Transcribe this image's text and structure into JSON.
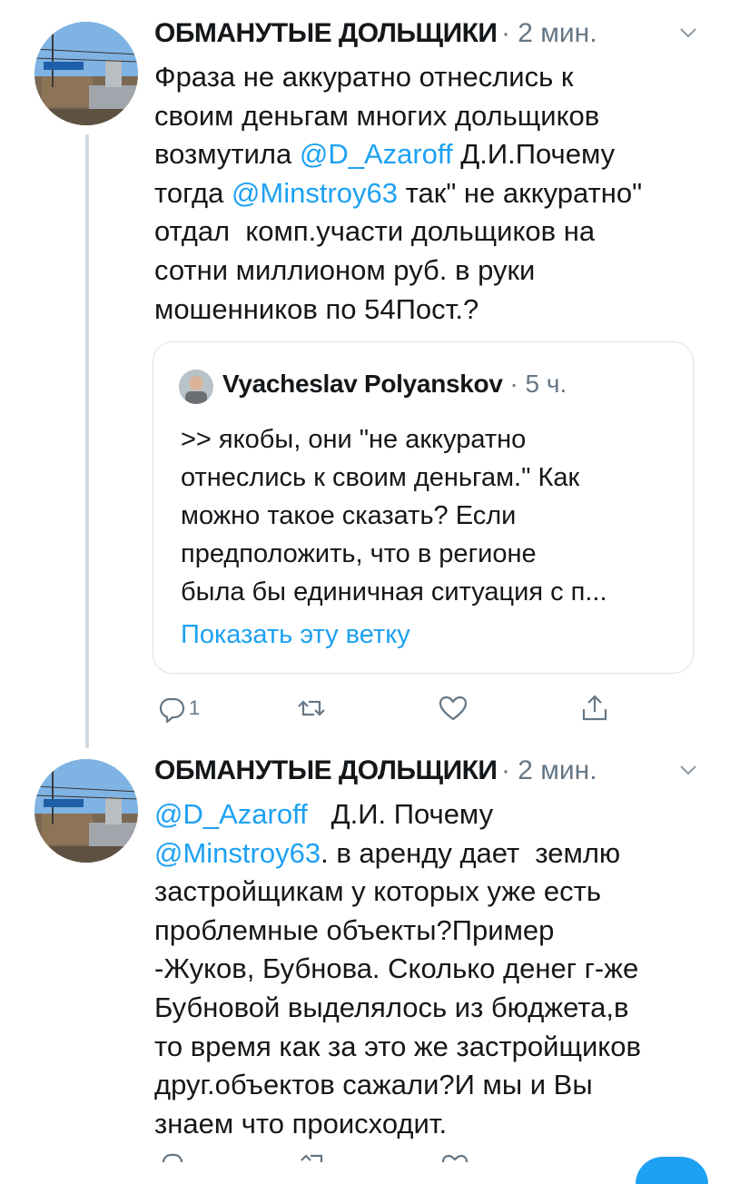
{
  "tweets": [
    {
      "author": "ОБМАНУТЫЕ ДОЛЬЩИКИ",
      "time": "· 2 мин.",
      "text_parts": [
        {
          "t": "Фраза не аккуратно отнеслись к\nсвоим деньгам многих дольщиков\nвозмутила "
        },
        {
          "t": "@D_Azaroff",
          "mention": true
        },
        {
          "t": " Д.И.Почему\nтогда "
        },
        {
          "t": "@Minstroy63",
          "mention": true
        },
        {
          "t": " так\" не аккуратно\"\nотдал  комп.участи дольщиков на\nсотни миллионом руб. в руки\nмошенников по 54Пост.?"
        }
      ],
      "quote": {
        "author": "Vyacheslav Polyanskov",
        "time": "· 5 ч.",
        "text": ">> якобы, они \"не аккуратно\nотнеслись к своим деньгам.\" Как\nможно такое сказать? Если\nпредположить, что в регионе\nбыла бы единичная ситуация с п...",
        "link": "Показать эту ветку"
      },
      "actions": {
        "reply_count": "1",
        "retweet_count": "",
        "like_count": ""
      }
    },
    {
      "author": "ОБМАНУТЫЕ ДОЛЬЩИКИ",
      "time": "· 2 мин.",
      "text_parts": [
        {
          "t": "@D_Azaroff",
          "mention": true
        },
        {
          "t": "   Д.И. Почему\n"
        },
        {
          "t": "@Minstroy63",
          "mention": true
        },
        {
          "t": ". в аренду дает  землю\nзастройщикам у которых уже есть\nпроблемные объекты?Пример\n-Жуков, Бубнова. Сколько денег г-же\nБубновой выделялось из бюджета,в\nто время как за это же застройщиков\nдруг.объектов сажали?И мы и Вы\nзнаем что происходит."
        }
      ]
    }
  ],
  "colors": {
    "accent": "#1da1f2",
    "muted": "#657786",
    "text": "#14171a",
    "border": "#dbe1e6"
  },
  "icons": [
    "reply-icon",
    "retweet-icon",
    "like-icon",
    "share-icon",
    "chevron-down-icon"
  ]
}
